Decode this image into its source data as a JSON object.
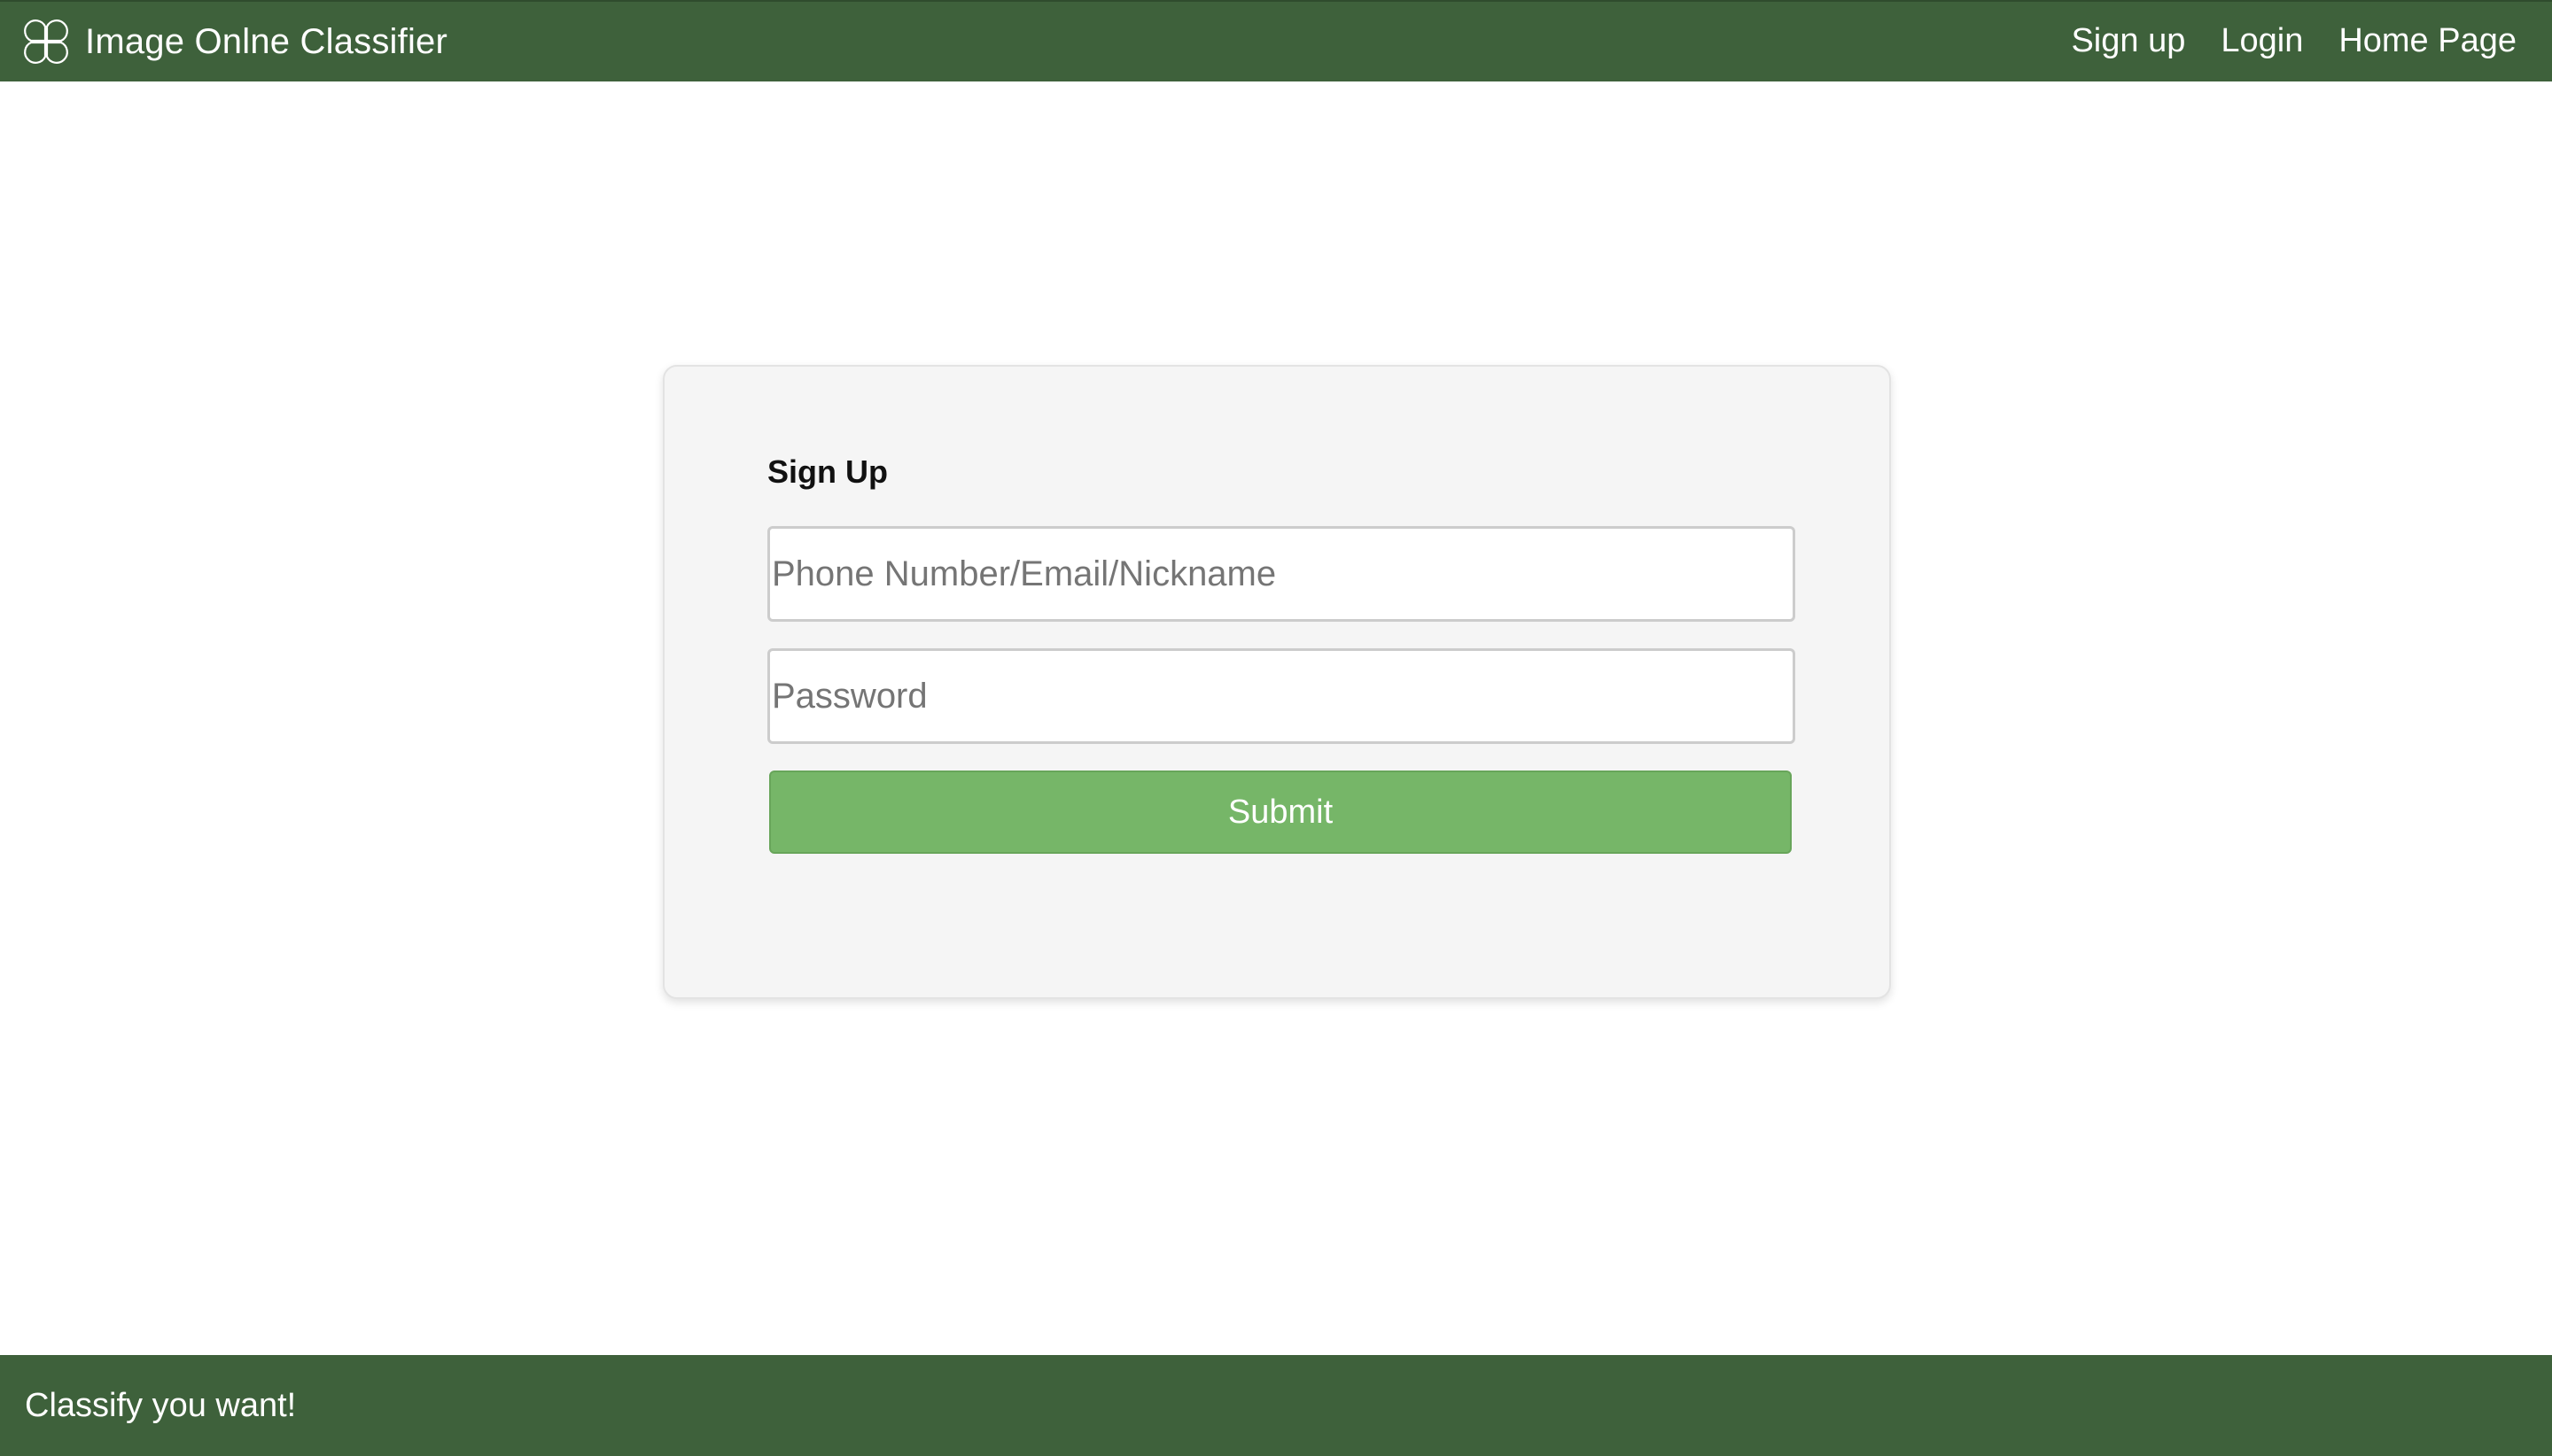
{
  "navbar": {
    "brand_icon": "four-petal-logo-icon",
    "brand_title": "Image Onlne Classifier",
    "links": [
      {
        "label": "Sign up"
      },
      {
        "label": "Login"
      },
      {
        "label": "Home Page"
      }
    ],
    "background_color": "#3e613b"
  },
  "signup_form": {
    "title": "Sign Up",
    "username_field": {
      "value": "",
      "placeholder": "Phone Number/Email/Nickname"
    },
    "password_field": {
      "value": "",
      "placeholder": "Password"
    },
    "submit_label": "Submit",
    "submit_color": "#76b668"
  },
  "footer": {
    "text": "Classify you want!"
  }
}
